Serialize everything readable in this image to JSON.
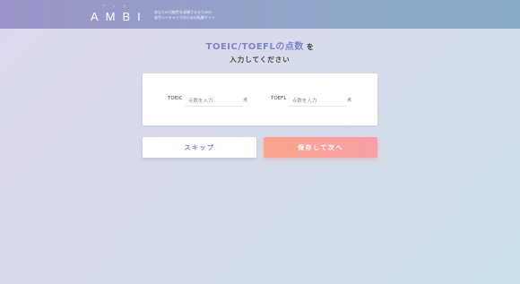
{
  "header": {
    "logo_ruby": "アンビ",
    "logo_text": "AMBI",
    "tagline_line1": "あなたの可能性を発揮させるための",
    "tagline_line2": "若手ハイキャリアのための転職サイト",
    "background": "#9a93c7"
  },
  "page": {
    "title_highlight": "TOEIC/TOEFLの点数",
    "title_suffix": "を",
    "title_line2": "入力してください",
    "accent": "#7f85c9"
  },
  "form": {
    "toeic": {
      "label": "TOEIC",
      "value": "",
      "placeholder": "点数を入力",
      "unit": "点"
    },
    "toefl": {
      "label": "TOEFL",
      "value": "",
      "placeholder": "点数を入力",
      "unit": "点"
    }
  },
  "actions": {
    "skip_label": "スキップ",
    "save_label": "保存して次へ",
    "save_color": "#f9a58a"
  }
}
